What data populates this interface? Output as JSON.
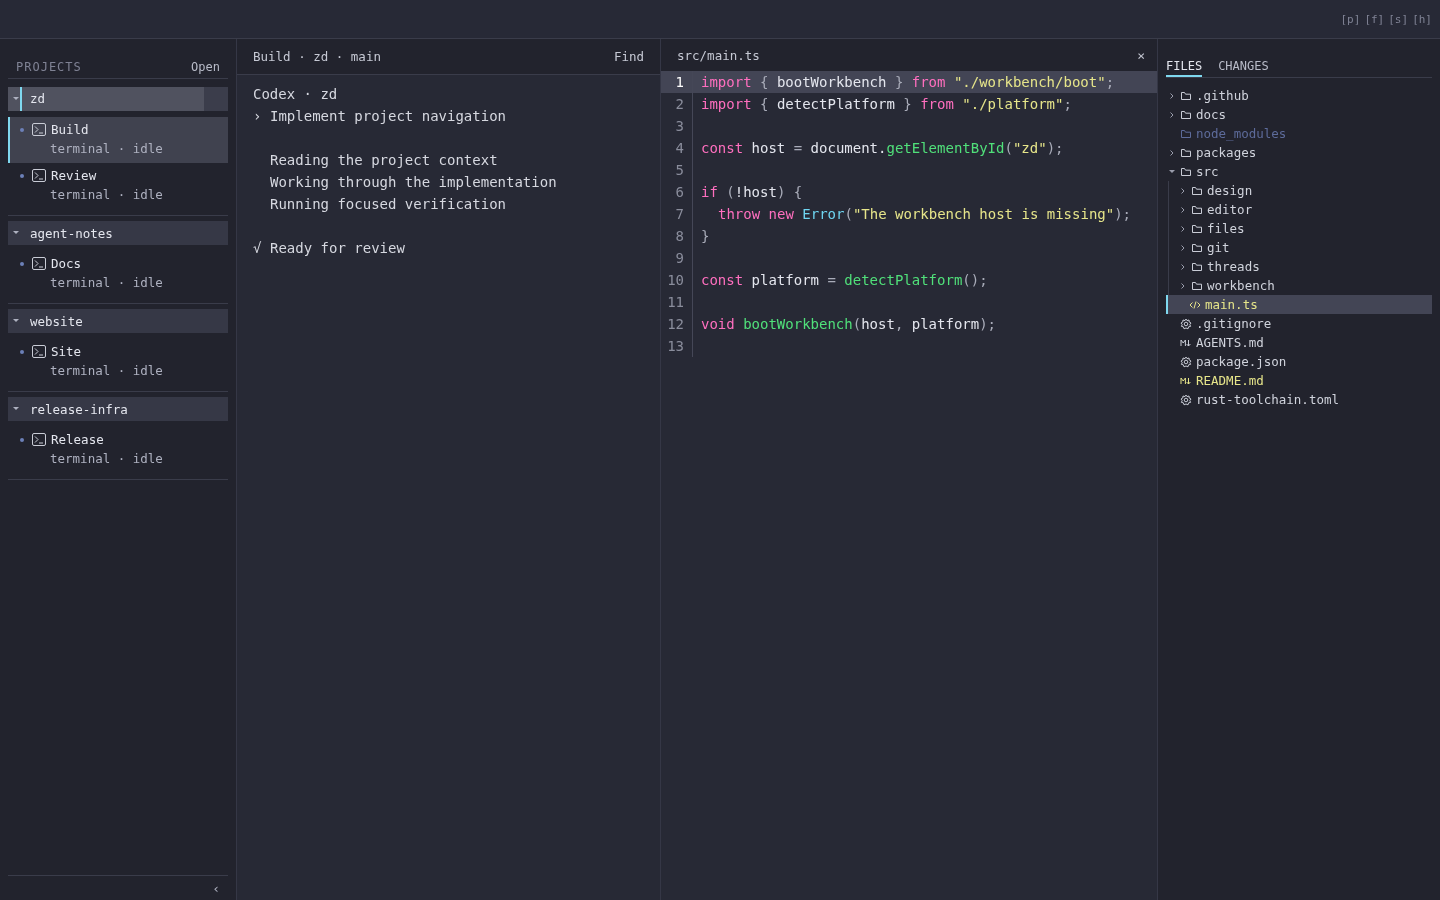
{
  "topbar": {
    "shortcuts": [
      "[p]",
      "[f]",
      "[s]",
      "[h]"
    ]
  },
  "sidebar": {
    "title": "PROJECTS",
    "action": "Open",
    "collapse": "‹",
    "projects": [
      {
        "name": "zd",
        "expanded": true,
        "selected": true,
        "sessions": [
          {
            "name": "Build",
            "detail": "terminal · idle",
            "selected": true
          },
          {
            "name": "Review",
            "detail": "terminal · idle",
            "selected": false
          }
        ]
      },
      {
        "name": "agent-notes",
        "expanded": true,
        "selected": false,
        "sessions": [
          {
            "name": "Docs",
            "detail": "terminal · idle",
            "selected": false
          }
        ]
      },
      {
        "name": "website",
        "expanded": true,
        "selected": false,
        "sessions": [
          {
            "name": "Site",
            "detail": "terminal · idle",
            "selected": false
          }
        ]
      },
      {
        "name": "release-infra",
        "expanded": true,
        "selected": false,
        "sessions": [
          {
            "name": "Release",
            "detail": "terminal · idle",
            "selected": false
          }
        ]
      }
    ]
  },
  "thread": {
    "breadcrumb": "Build · zd · main",
    "find": "Find",
    "lines": [
      {
        "kind": "heading",
        "text": "Codex · zd"
      },
      {
        "kind": "prompt",
        "marker": "›",
        "text": "Implement project navigation"
      },
      {
        "kind": "step",
        "text": "Reading the project context"
      },
      {
        "kind": "step",
        "text": "Working through the implementation"
      },
      {
        "kind": "step",
        "text": "Running focused verification"
      },
      {
        "kind": "done",
        "marker": "√",
        "text": "Ready for review"
      }
    ]
  },
  "editor": {
    "path": "src/main.ts",
    "close": "×",
    "lines": [
      {
        "number": "1",
        "current": true,
        "tokens": [
          {
            "kind": "kw",
            "text": "import"
          },
          {
            "kind": "punct",
            "text": " { "
          },
          {
            "kind": "plain",
            "text": "bootWorkbench"
          },
          {
            "kind": "punct",
            "text": " } "
          },
          {
            "kind": "kw",
            "text": "from"
          },
          {
            "kind": "str",
            "text": " \"./workbench/boot\""
          },
          {
            "kind": "punct",
            "text": ";"
          }
        ]
      },
      {
        "number": "2",
        "current": false,
        "tokens": [
          {
            "kind": "kw",
            "text": "import"
          },
          {
            "kind": "punct",
            "text": " { "
          },
          {
            "kind": "plain",
            "text": "detectPlatform"
          },
          {
            "kind": "punct",
            "text": " } "
          },
          {
            "kind": "kw",
            "text": "from"
          },
          {
            "kind": "str",
            "text": " \"./platform\""
          },
          {
            "kind": "punct",
            "text": ";"
          }
        ]
      },
      {
        "number": "3",
        "current": false
      },
      {
        "number": "4",
        "current": false,
        "tokens": [
          {
            "kind": "kw",
            "text": "const"
          },
          {
            "kind": "plain",
            "text": " host "
          },
          {
            "kind": "punct",
            "text": "="
          },
          {
            "kind": "plain",
            "text": " document."
          },
          {
            "kind": "fn",
            "text": "getElementById"
          },
          {
            "kind": "punct",
            "text": "("
          },
          {
            "kind": "str",
            "text": "\"zd\""
          },
          {
            "kind": "punct",
            "text": ");"
          }
        ]
      },
      {
        "number": "5",
        "current": false
      },
      {
        "number": "6",
        "current": false,
        "tokens": [
          {
            "kind": "kw",
            "text": "if"
          },
          {
            "kind": "punct",
            "text": " ("
          },
          {
            "kind": "plain",
            "text": "!host"
          },
          {
            "kind": "punct",
            "text": ") {"
          }
        ]
      },
      {
        "number": "7",
        "current": false,
        "indented": true,
        "tokens": [
          {
            "kind": "kw",
            "text": "throw new"
          },
          {
            "kind": "type",
            "text": " Error"
          },
          {
            "kind": "punct",
            "text": "("
          },
          {
            "kind": "str",
            "text": "\"The workbench host is missing\""
          },
          {
            "kind": "punct",
            "text": ");"
          }
        ]
      },
      {
        "number": "8",
        "current": false,
        "tokens": [
          {
            "kind": "punct",
            "text": "}"
          }
        ]
      },
      {
        "number": "9",
        "current": false
      },
      {
        "number": "10",
        "current": false,
        "tokens": [
          {
            "kind": "kw",
            "text": "const"
          },
          {
            "kind": "plain",
            "text": " platform "
          },
          {
            "kind": "punct",
            "text": "="
          },
          {
            "kind": "fn",
            "text": " detectPlatform"
          },
          {
            "kind": "punct",
            "text": "();"
          }
        ]
      },
      {
        "number": "11",
        "current": false
      },
      {
        "number": "12",
        "current": false,
        "tokens": [
          {
            "kind": "kw",
            "text": "void"
          },
          {
            "kind": "fn",
            "text": " bootWorkbench"
          },
          {
            "kind": "punct",
            "text": "("
          },
          {
            "kind": "plain",
            "text": "host"
          },
          {
            "kind": "punct",
            "text": ", "
          },
          {
            "kind": "plain",
            "text": "platform"
          },
          {
            "kind": "punct",
            "text": ");"
          }
        ]
      },
      {
        "number": "13",
        "current": false
      }
    ]
  },
  "explorer": {
    "tabs": [
      {
        "label": "FILES",
        "selected": true
      },
      {
        "label": "CHANGES",
        "selected": false
      }
    ],
    "tree": [
      {
        "kind": "folder",
        "name": ".github",
        "expanded": false,
        "selected": false,
        "ignored": false,
        "modified": false
      },
      {
        "kind": "folder",
        "name": "docs",
        "expanded": false,
        "selected": false,
        "ignored": false,
        "modified": false
      },
      {
        "kind": "folder",
        "name": "node_modules",
        "selected": false,
        "ignored": true,
        "modified": false
      },
      {
        "kind": "folder",
        "name": "packages",
        "expanded": false,
        "selected": false,
        "ignored": false,
        "modified": false
      },
      {
        "kind": "folder",
        "name": "src",
        "expanded": true,
        "selected": false,
        "ignored": false,
        "modified": false,
        "children": [
          {
            "kind": "folder",
            "name": "design",
            "expanded": false,
            "selected": false,
            "ignored": false,
            "modified": false
          },
          {
            "kind": "folder",
            "name": "editor",
            "expanded": false,
            "selected": false,
            "ignored": false,
            "modified": false
          },
          {
            "kind": "folder",
            "name": "files",
            "expanded": false,
            "selected": false,
            "ignored": false,
            "modified": false
          },
          {
            "kind": "folder",
            "name": "git",
            "expanded": false,
            "selected": false,
            "ignored": false,
            "modified": false
          },
          {
            "kind": "folder",
            "name": "threads",
            "expanded": false,
            "selected": false,
            "ignored": false,
            "modified": false
          },
          {
            "kind": "folder",
            "name": "workbench",
            "expanded": false,
            "selected": false,
            "ignored": false,
            "modified": false
          },
          {
            "kind": "code",
            "name": "main.ts",
            "selected": true,
            "ignored": false,
            "modified": true
          }
        ]
      },
      {
        "kind": "config",
        "name": ".gitignore",
        "selected": false,
        "ignored": false,
        "modified": false
      },
      {
        "kind": "markdown",
        "name": "AGENTS.md",
        "selected": false,
        "ignored": false,
        "modified": false
      },
      {
        "kind": "config",
        "name": "package.json",
        "selected": false,
        "ignored": false,
        "modified": false
      },
      {
        "kind": "markdown",
        "name": "README.md",
        "selected": false,
        "ignored": false,
        "modified": true
      },
      {
        "kind": "config",
        "name": "rust-toolchain.toml",
        "selected": false,
        "ignored": false,
        "modified": false
      }
    ]
  }
}
